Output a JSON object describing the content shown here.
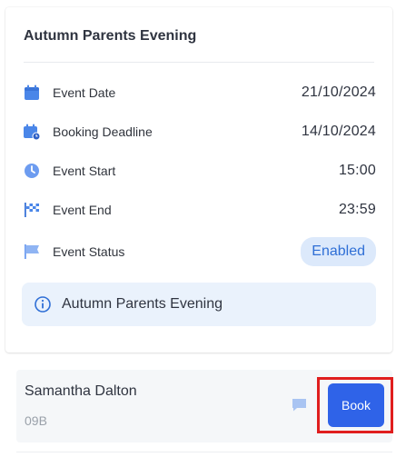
{
  "event": {
    "title": "Autumn Parents Evening",
    "details": [
      {
        "icon": "calendar-icon",
        "label": "Event Date",
        "value": "21/10/2024"
      },
      {
        "icon": "calendar-clock-icon",
        "label": "Booking Deadline",
        "value": "14/10/2024"
      },
      {
        "icon": "clock-icon",
        "label": "Event Start",
        "value": "15:00"
      },
      {
        "icon": "checkered-flag-icon",
        "label": "Event End",
        "value": "23:59"
      },
      {
        "icon": "flag-icon",
        "label": "Event Status",
        "value": "Enabled"
      }
    ],
    "info_text": "Autumn Parents Evening"
  },
  "booking": {
    "name": "Samantha Dalton",
    "class": "09B",
    "button_label": "Book"
  },
  "colors": {
    "accent": "#2f63e8",
    "icon_blue": "#4a86e8",
    "badge_bg": "#dce9fb",
    "badge_text": "#2f6fd6",
    "highlight": "#e01e1e"
  }
}
